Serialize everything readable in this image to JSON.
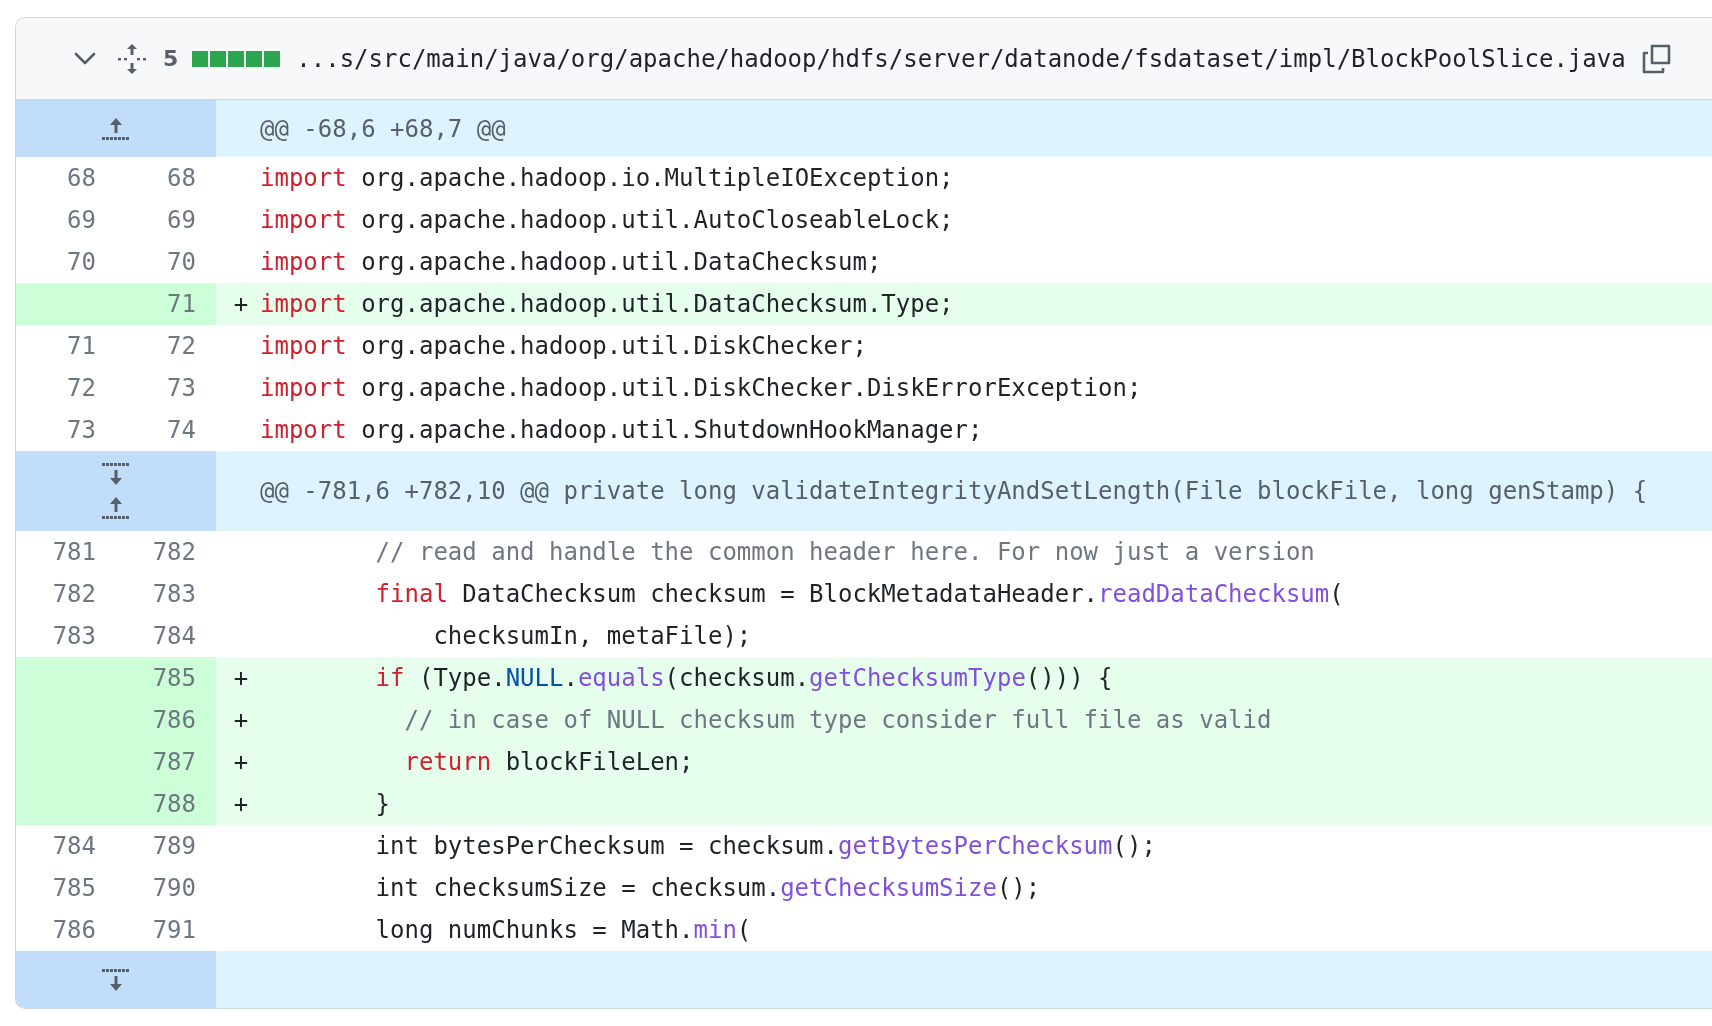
{
  "file_header": {
    "expanded": true,
    "changes": "5",
    "diffstat": [
      {
        "kind": "added"
      },
      {
        "kind": "added"
      },
      {
        "kind": "added"
      },
      {
        "kind": "added"
      },
      {
        "kind": "added"
      }
    ],
    "path": "...s/src/main/java/org/apache/hadoop/hdfs/server/datanode/fsdataset/impl/BlockPoolSlice.java"
  },
  "rows": [
    {
      "kind": "hunk",
      "expand_up": true,
      "expand_down": false,
      "text": "@@ -68,6 +68,7 @@"
    },
    {
      "kind": "context",
      "old": "68",
      "new": "68",
      "tokens": [
        {
          "kind": "keyword",
          "text": "import"
        },
        {
          "kind": "plain",
          "text": " org.apache.hadoop.io.MultipleIOException;"
        }
      ]
    },
    {
      "kind": "context",
      "old": "69",
      "new": "69",
      "tokens": [
        {
          "kind": "keyword",
          "text": "import"
        },
        {
          "kind": "plain",
          "text": " org.apache.hadoop.util.AutoCloseableLock;"
        }
      ]
    },
    {
      "kind": "context",
      "old": "70",
      "new": "70",
      "tokens": [
        {
          "kind": "keyword",
          "text": "import"
        },
        {
          "kind": "plain",
          "text": " org.apache.hadoop.util.DataChecksum;"
        }
      ]
    },
    {
      "kind": "addition",
      "new": "71",
      "marker": "+",
      "tokens": [
        {
          "kind": "keyword",
          "text": "import"
        },
        {
          "kind": "plain",
          "text": " org.apache.hadoop.util.DataChecksum.Type;"
        }
      ]
    },
    {
      "kind": "context",
      "old": "71",
      "new": "72",
      "tokens": [
        {
          "kind": "keyword",
          "text": "import"
        },
        {
          "kind": "plain",
          "text": " org.apache.hadoop.util.DiskChecker;"
        }
      ]
    },
    {
      "kind": "context",
      "old": "72",
      "new": "73",
      "tokens": [
        {
          "kind": "keyword",
          "text": "import"
        },
        {
          "kind": "plain",
          "text": " org.apache.hadoop.util.DiskChecker.DiskErrorException;"
        }
      ]
    },
    {
      "kind": "context",
      "old": "73",
      "new": "74",
      "tokens": [
        {
          "kind": "keyword",
          "text": "import"
        },
        {
          "kind": "plain",
          "text": " org.apache.hadoop.util.ShutdownHookManager;"
        }
      ]
    },
    {
      "kind": "hunk",
      "expand_up": true,
      "expand_down": true,
      "text": "@@ -781,6 +782,10 @@ private long validateIntegrityAndSetLength(File blockFile, long genStamp) {"
    },
    {
      "kind": "context",
      "old": "781",
      "new": "782",
      "tokens": [
        {
          "kind": "comment",
          "text": "        // read and handle the common header here. For now just a version"
        }
      ]
    },
    {
      "kind": "context",
      "old": "782",
      "new": "783",
      "tokens": [
        {
          "kind": "keyword",
          "text": "        final"
        },
        {
          "kind": "plain",
          "text": " DataChecksum checksum = BlockMetadataHeader."
        },
        {
          "kind": "function",
          "text": "readDataChecksum"
        },
        {
          "kind": "plain",
          "text": "("
        }
      ]
    },
    {
      "kind": "context",
      "old": "783",
      "new": "784",
      "tokens": [
        {
          "kind": "plain",
          "text": "            checksumIn, metaFile);"
        }
      ]
    },
    {
      "kind": "addition",
      "new": "785",
      "marker": "+",
      "tokens": [
        {
          "kind": "keyword",
          "text": "        if"
        },
        {
          "kind": "plain",
          "text": " (Type."
        },
        {
          "kind": "constant",
          "text": "NULL"
        },
        {
          "kind": "plain",
          "text": "."
        },
        {
          "kind": "function",
          "text": "equals"
        },
        {
          "kind": "plain",
          "text": "(checksum."
        },
        {
          "kind": "function",
          "text": "getChecksumType"
        },
        {
          "kind": "plain",
          "text": "())) {"
        }
      ]
    },
    {
      "kind": "addition",
      "new": "786",
      "marker": "+",
      "tokens": [
        {
          "kind": "comment",
          "text": "          // in case of NULL checksum type consider full file as valid"
        }
      ]
    },
    {
      "kind": "addition",
      "new": "787",
      "marker": "+",
      "tokens": [
        {
          "kind": "keyword",
          "text": "          return"
        },
        {
          "kind": "plain",
          "text": " blockFileLen;"
        }
      ]
    },
    {
      "kind": "addition",
      "new": "788",
      "marker": "+",
      "tokens": [
        {
          "kind": "plain",
          "text": "        }"
        }
      ]
    },
    {
      "kind": "context",
      "old": "784",
      "new": "789",
      "tokens": [
        {
          "kind": "plain",
          "text": "        int bytesPerChecksum = checksum."
        },
        {
          "kind": "function",
          "text": "getBytesPerChecksum"
        },
        {
          "kind": "plain",
          "text": "();"
        }
      ]
    },
    {
      "kind": "context",
      "old": "785",
      "new": "790",
      "tokens": [
        {
          "kind": "plain",
          "text": "        int checksumSize = checksum."
        },
        {
          "kind": "function",
          "text": "getChecksumSize"
        },
        {
          "kind": "plain",
          "text": "();"
        }
      ]
    },
    {
      "kind": "context",
      "old": "786",
      "new": "791",
      "tokens": [
        {
          "kind": "plain",
          "text": "        long numChunks = Math."
        },
        {
          "kind": "function",
          "text": "min"
        },
        {
          "kind": "plain",
          "text": "("
        }
      ]
    },
    {
      "kind": "hunk",
      "expand_up": false,
      "expand_down": true
    }
  ]
}
